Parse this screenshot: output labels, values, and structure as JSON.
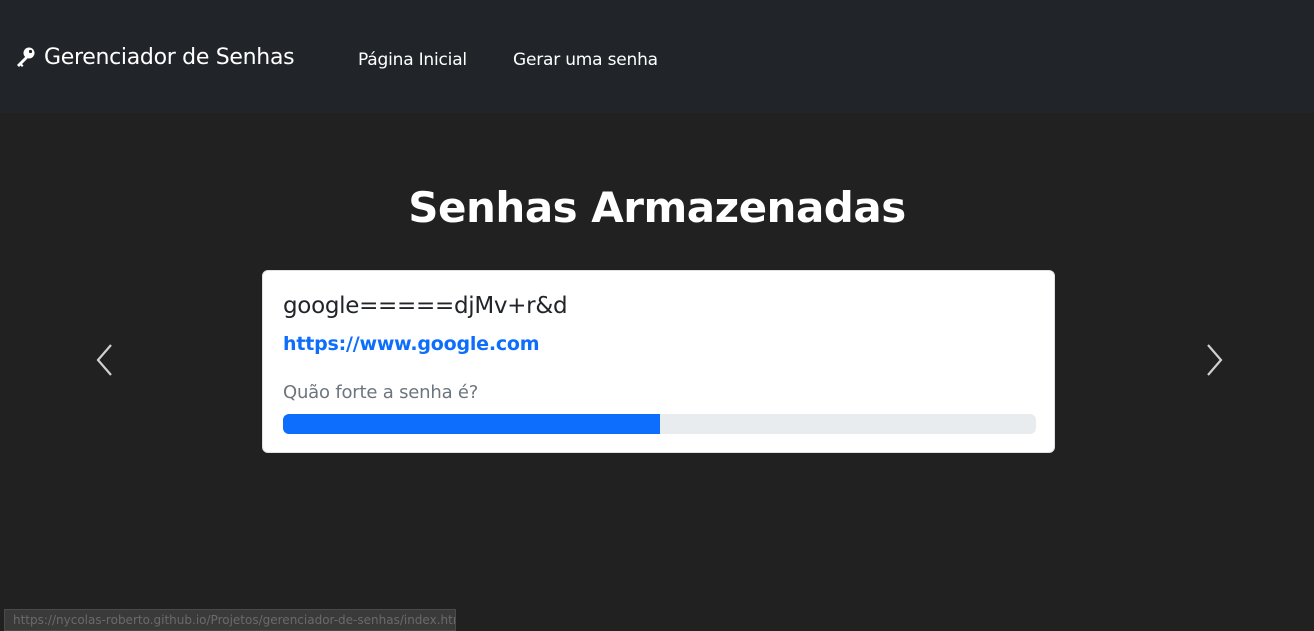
{
  "navbar": {
    "brand_label": "Gerenciador de Senhas",
    "links": [
      {
        "label": "Página Inicial"
      },
      {
        "label": "Gerar uma senha"
      }
    ]
  },
  "main": {
    "title": "Senhas Armazenadas"
  },
  "card": {
    "password": "google=====djMv+r&d",
    "url": "https://www.google.com",
    "strength_label": "Quão forte a senha é?",
    "strength_percent": 50
  },
  "status_bar": {
    "url": "https://nycolas-roberto.github.io/Projetos/gerenciador-de-senhas/index.html#"
  },
  "colors": {
    "navbar_bg": "#212529",
    "page_bg": "#212121",
    "accent": "#0d6efd"
  },
  "icons": {
    "brand": "key-icon",
    "prev": "chevron-left-icon",
    "next": "chevron-right-icon"
  }
}
